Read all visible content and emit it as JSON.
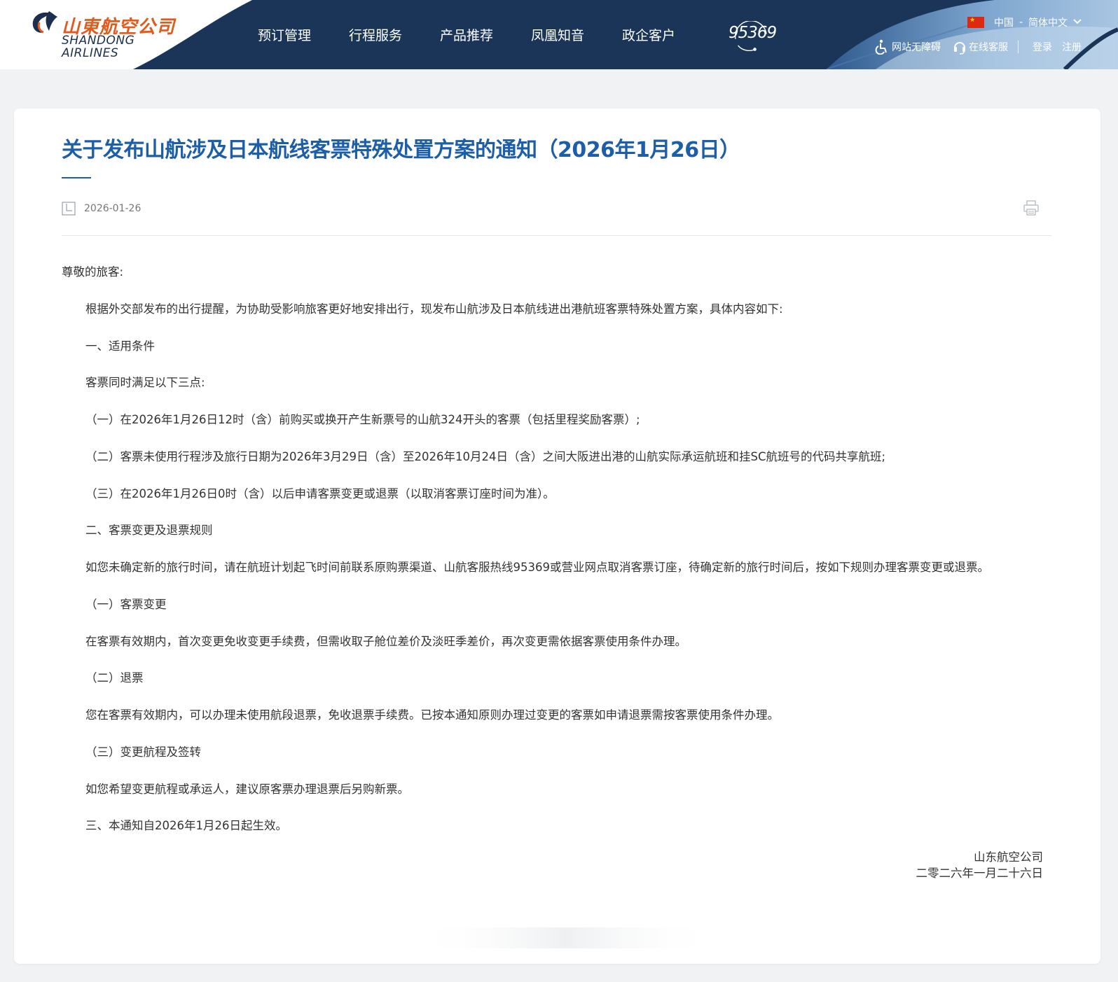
{
  "brand": {
    "name_cn": "山東航空公司",
    "name_en_line1": "SHANDONG",
    "name_en_line2": "AIRLINES",
    "primary_color": "#1a3558",
    "accent_color": "#e25a1c",
    "logo_icon": "shandong-airlines-logo-icon"
  },
  "nav": {
    "items": [
      {
        "label": "预订管理"
      },
      {
        "label": "行程服务"
      },
      {
        "label": "产品推荐"
      },
      {
        "label": "凤凰知音"
      },
      {
        "label": "政企客户"
      }
    ],
    "hotline": "95369",
    "hotline_icon": "hotline-headset-icon"
  },
  "region": {
    "flag_icon": "china-flag-icon",
    "country": "中国",
    "separator": "-",
    "language": "简体中文",
    "dropdown_icon": "chevron-down-icon"
  },
  "toolbar": {
    "accessibility_label": "网站无障碍",
    "accessibility_icon": "wheelchair-icon",
    "service_label": "在线客服",
    "service_icon": "headset-icon",
    "login_label": "登录",
    "register_label": "注册"
  },
  "article": {
    "title": "关于发布山航涉及日本航线客票特殊处置方案的通知（2026年1月26日）",
    "date": "2026-01-26",
    "date_icon": "calendar-icon",
    "print_icon": "print-icon",
    "title_color": "#1d5ea8",
    "greeting": "尊敬的旅客:",
    "paragraphs": [
      "根据外交部发布的出行提醒，为协助受影响旅客更好地安排出行，现发布山航涉及日本航线进出港航班客票特殊处置方案，具体内容如下:",
      "一、适用条件",
      " 客票同时满足以下三点:",
      "（一）在2026年1月26日12时（含）前购买或换开产生新票号的山航324开头的客票（包括里程奖励客票）;",
      "（二）客票未使用行程涉及旅行日期为2026年3月29日（含）至2026年10月24日（含）之间大阪进出港的山航实际承运航班和挂SC航班号的代码共享航班;",
      "（三）在2026年1月26日0时（含）以后申请客票变更或退票（以取消客票订座时间为准）。",
      "二、客票变更及退票规则",
      "如您未确定新的旅行时间，请在航班计划起飞时间前联系原购票渠道、山航客服热线95369或营业网点取消客票订座，待确定新的旅行时间后，按如下规则办理客票变更或退票。",
      "（一）客票变更",
      "在客票有效期内，首次变更免收变更手续费，但需收取子舱位差价及淡旺季差价，再次变更需依据客票使用条件办理。",
      "（二）退票",
      "您在客票有效期内，可以办理未使用航段退票，免收退票手续费。已按本通知原则办理过变更的客票如申请退票需按客票使用条件办理。",
      "（三）变更航程及签转",
      "如您希望变更航程或承运人，建议原客票办理退票后另购新票。",
      "三、本通知自2026年1月26日起生效。"
    ],
    "signature_org": "山东航空公司",
    "signature_date": "二零二六年一月二十六日"
  }
}
